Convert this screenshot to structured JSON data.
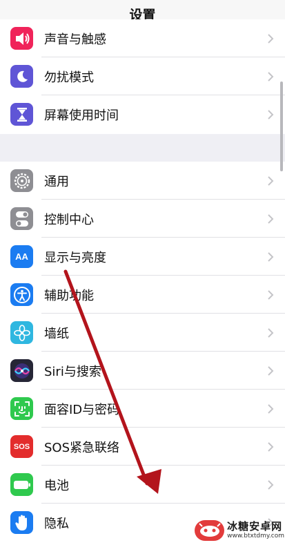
{
  "header": {
    "title": "设置"
  },
  "group1": {
    "items": [
      {
        "label": "声音与触感",
        "icon": "speaker-icon",
        "color": "#f0245a"
      },
      {
        "label": "勿扰模式",
        "icon": "moon-icon",
        "color": "#5f55d6"
      },
      {
        "label": "屏幕使用时间",
        "icon": "hourglass-icon",
        "color": "#5f55d6"
      }
    ]
  },
  "group2": {
    "items": [
      {
        "label": "通用",
        "icon": "gear-icon",
        "color": "#8e8e93"
      },
      {
        "label": "控制中心",
        "icon": "toggles-icon",
        "color": "#8e8e93"
      },
      {
        "label": "显示与亮度",
        "icon": "aa-icon",
        "icon_text": "AA",
        "color": "#1b7cf1"
      },
      {
        "label": "辅助功能",
        "icon": "accessibility-icon",
        "color": "#1b7cf1"
      },
      {
        "label": "墙纸",
        "icon": "flower-icon",
        "color": "#2fb7e0"
      },
      {
        "label": "Siri与搜索",
        "icon": "siri-icon",
        "color": "#262636"
      },
      {
        "label": "面容ID与密码",
        "icon": "faceid-icon",
        "color": "#2fc94e"
      },
      {
        "label": "SOS紧急联络",
        "icon": "sos-icon",
        "icon_text": "SOS",
        "color": "#e32c2c"
      },
      {
        "label": "电池",
        "icon": "battery-icon",
        "color": "#2fc94e"
      },
      {
        "label": "隐私",
        "icon": "hand-icon",
        "color": "#1b7cf1"
      }
    ]
  },
  "annotation": {
    "color": "#b3141c"
  },
  "watermark": {
    "name": "冰糖安卓网",
    "url": "www.btxtdmy.com",
    "color": "#e23b3b"
  }
}
